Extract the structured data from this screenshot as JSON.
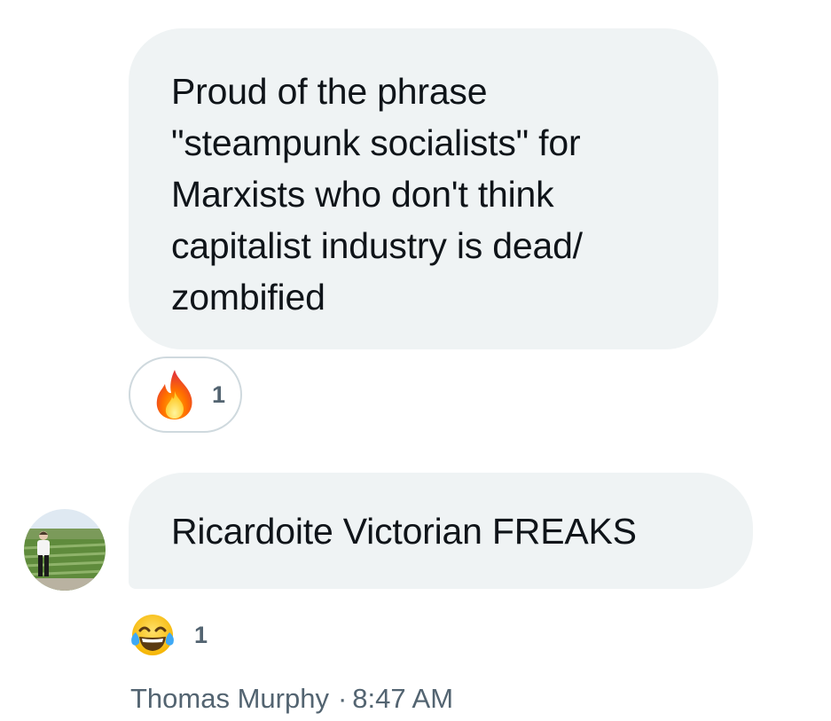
{
  "messages": [
    {
      "text": "Proud of the phrase\n\"steampunk socialists\" for\nMarxists who don't think\ncapitalist industry is dead/\nzombified",
      "reaction": {
        "emoji": "fire-emoji",
        "count": "1"
      }
    },
    {
      "text": "Ricardoite Victorian FREAKS",
      "reaction": {
        "emoji": "tears-of-joy-emoji",
        "count": "1"
      }
    }
  ],
  "meta": {
    "sender": "Thomas Murphy",
    "separator": "·",
    "time": "8:47 AM"
  },
  "colors": {
    "bubble": "#eff3f4",
    "secondary_text": "#536471",
    "pill_border": "#cfd9de"
  }
}
